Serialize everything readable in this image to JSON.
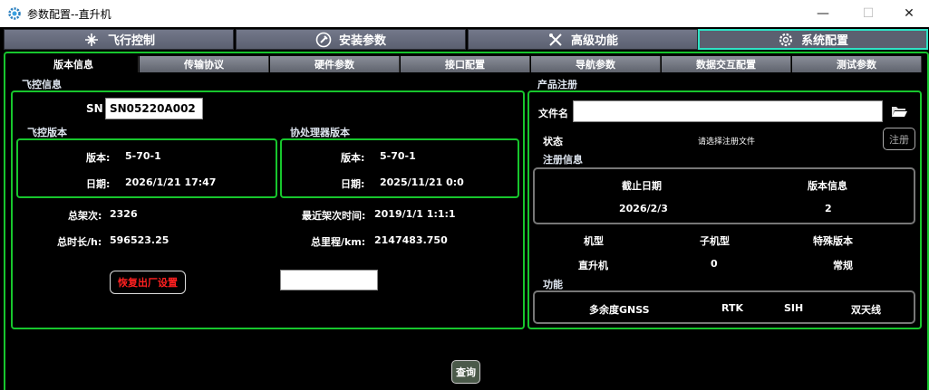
{
  "window": {
    "title": "参数配置--直升机",
    "minimize": "—",
    "maximize": "☐",
    "close": "✕"
  },
  "main_tabs": [
    {
      "label": "飞行控制",
      "icon": "drone-icon"
    },
    {
      "label": "安装参数",
      "icon": "wrench-circle-icon"
    },
    {
      "label": "高级功能",
      "icon": "tools-icon"
    },
    {
      "label": "系统配置",
      "icon": "gear-icon"
    }
  ],
  "sub_tabs": [
    "版本信息",
    "传输协议",
    "硬件参数",
    "接口配置",
    "导航参数",
    "数据交互配置",
    "测试参数"
  ],
  "fc_info": {
    "section": "飞控信息",
    "sn_label": "SN",
    "sn_value": "SN05220A002",
    "fc_version_title": "飞控版本",
    "fc_version_label": "版本:",
    "fc_version_value": "5-70-1",
    "fc_date_label": "日期:",
    "fc_date_value": "2026/1/21 17:47",
    "co_version_title": "协处理器版本",
    "co_version_label": "版本:",
    "co_version_value": "5-70-1",
    "co_date_label": "日期:",
    "co_date_value": "2025/11/21 0:0",
    "total_flights_label": "总架次:",
    "total_flights_value": "2326",
    "recent_flight_label": "最近架次时间:",
    "recent_flight_value": "2019/1/1 1:1:1",
    "total_hours_label": "总时长/h:",
    "total_hours_value": "596523.25",
    "total_distance_label": "总里程/km:",
    "total_distance_value": "2147483.750",
    "reset_button": "恢复出厂设置",
    "blank_field": ""
  },
  "product_reg": {
    "section": "产品注册",
    "file_label": "文件名",
    "file_value": "",
    "status_label": "状态",
    "status_value": "请选择注册文件",
    "register_button": "注册",
    "reg_info_label": "注册信息",
    "expiry_header": "截止日期",
    "version_header": "版本信息",
    "expiry_value": "2026/2/3",
    "version_value": "2",
    "model_header": "机型",
    "submodel_header": "子机型",
    "special_header": "特殊版本",
    "model_value": "直升机",
    "submodel_value": "0",
    "special_value": "常规",
    "function_label": "功能",
    "functions": [
      "多余度GNSS",
      "RTK",
      "SIH",
      "双天线"
    ]
  },
  "query_button": "查询"
}
